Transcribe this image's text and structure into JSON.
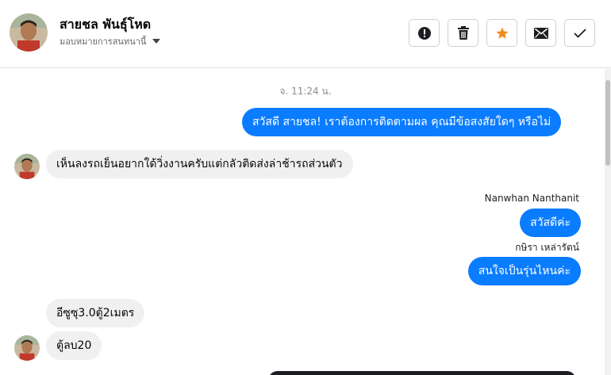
{
  "header": {
    "contact_name": "สายชล พันธุ์โหด",
    "assign_label": "มอบหมายการสนทนานี้",
    "actions": [
      {
        "name": "spam-button",
        "icon": "alert-circle-icon"
      },
      {
        "name": "delete-button",
        "icon": "trash-icon"
      },
      {
        "name": "star-button",
        "icon": "star-icon"
      },
      {
        "name": "mark-unread-button",
        "icon": "mail-icon"
      },
      {
        "name": "mark-done-button",
        "icon": "check-icon"
      }
    ],
    "star_color": "#f28b1f"
  },
  "thread": {
    "timestamp": "จ. 11:24 น.",
    "messages": [
      {
        "direction": "out",
        "text": "สวัสดี สายชล! เราต้องการติดตามผล คุณมีข้อสงสัยใดๆ หรือไม่"
      },
      {
        "direction": "in",
        "text": "เห็นลงรถเย็นอยากใด้วิ่งงานครับแต่กลัวติดส่งล่าช้ารถส่วนตัว"
      },
      {
        "direction": "out",
        "sender": "Nanwhan Nanthanit",
        "text": "สวัสดีค่ะ"
      },
      {
        "direction": "out",
        "sender": "กษิรา เหล่ารัตน์",
        "text": "สนใจเป็นรุ่นไหนค่ะ"
      },
      {
        "direction": "in",
        "text": "อีซูซุ3.0ตู้2เมตร"
      },
      {
        "direction": "in",
        "text": "ตู้ลบ20"
      }
    ]
  },
  "colors": {
    "outgoing_bubble": "#0a7cff",
    "incoming_bubble": "#f0f0f0"
  }
}
